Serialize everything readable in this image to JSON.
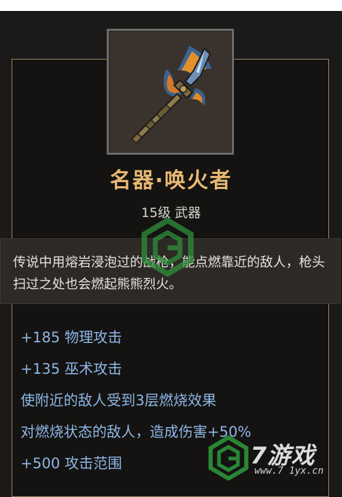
{
  "item": {
    "name": "名器·唤火者",
    "level": "15级 武器",
    "icon": "flaming-spear-icon",
    "lore": "传说中用熔岩浸泡过的战枪，能点燃靠近的敌人，枪头扫过之处也会燃起熊熊烈火。"
  },
  "stats": [
    "+185 物理攻击",
    "+135 巫术攻击",
    "使附近的敌人受到3层燃烧效果",
    "对燃烧状态的敌人，造成伤害+50%",
    "+500 攻击范围"
  ],
  "watermark": {
    "brand": "7游戏",
    "url": "www.7 1yx.cn",
    "logo_icon": "7yx-logo-icon"
  },
  "colors": {
    "name": "#e8b872",
    "stat": "#8eb6e6",
    "border": "#a08a5f"
  }
}
